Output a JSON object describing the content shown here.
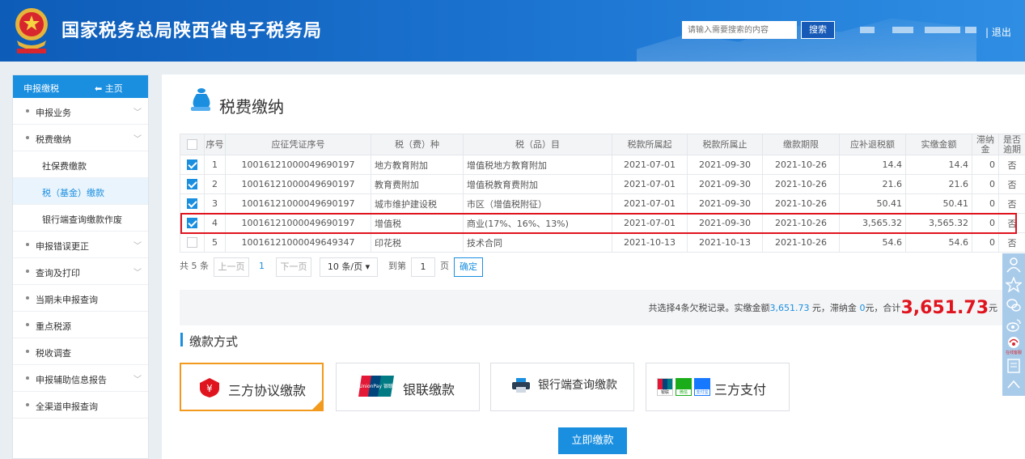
{
  "header": {
    "title": "国家税务总局陕西省电子税务局",
    "search_placeholder": "请输入需要搜索的内容",
    "search_label": "搜索",
    "separator": "|",
    "logout_label": "退出"
  },
  "sidebar": {
    "head_label": "申报缴税",
    "home_label": "主页",
    "items": [
      {
        "label": "申报业务",
        "expandable": true
      },
      {
        "label": "税费缴纳",
        "expandable": true
      },
      {
        "label": "社保费缴款",
        "sub": true
      },
      {
        "label": "税（基金）缴款",
        "sub": true,
        "active": true
      },
      {
        "label": "银行端查询缴款作废",
        "sub": true
      },
      {
        "label": "申报错误更正",
        "expandable": true
      },
      {
        "label": "查询及打印",
        "expandable": true
      },
      {
        "label": "当期未申报查询"
      },
      {
        "label": "重点税源"
      },
      {
        "label": "税收调查"
      },
      {
        "label": "申报辅助信息报告",
        "expandable": true
      },
      {
        "label": "全渠道申报查询"
      }
    ]
  },
  "page_title": "税费缴纳",
  "table": {
    "headers": [
      "",
      "序号",
      "应征凭证序号",
      "税（费）种",
      "税（品）目",
      "税款所属起",
      "税款所属止",
      "缴款期限",
      "应补退税额",
      "实缴金额",
      "滞纳金",
      "是否逾期"
    ],
    "rows": [
      {
        "checked": true,
        "cells": [
          "1",
          "10016121000049690197",
          "地方教育附加",
          "增值税地方教育附加",
          "2021-07-01",
          "2021-09-30",
          "2021-10-26",
          "14.4",
          "14.4",
          "0",
          "否"
        ]
      },
      {
        "checked": true,
        "cells": [
          "2",
          "10016121000049690197",
          "教育费附加",
          "增值税教育费附加",
          "2021-07-01",
          "2021-09-30",
          "2021-10-26",
          "21.6",
          "21.6",
          "0",
          "否"
        ]
      },
      {
        "checked": true,
        "cells": [
          "3",
          "10016121000049690197",
          "城市维护建设税",
          "市区（增值税附征）",
          "2021-07-01",
          "2021-09-30",
          "2021-10-26",
          "50.41",
          "50.41",
          "0",
          "否"
        ]
      },
      {
        "checked": true,
        "cells": [
          "4",
          "10016121000049690197",
          "增值税",
          "商业(17%、16%、13%)",
          "2021-07-01",
          "2021-09-30",
          "2021-10-26",
          "3,565.32",
          "3,565.32",
          "0",
          "否"
        ]
      },
      {
        "checked": false,
        "cells": [
          "5",
          "10016121000049649347",
          "印花税",
          "技术合同",
          "2021-10-13",
          "2021-10-13",
          "2021-10-26",
          "54.6",
          "54.6",
          "0",
          "否"
        ]
      }
    ]
  },
  "pager": {
    "total": "共 5 条",
    "prev": "上一页",
    "current": "1",
    "next": "下一页",
    "per_page": "10 条/页",
    "goto_prefix": "到第",
    "goto_value": "1",
    "goto_suffix": "页",
    "confirm": "确定"
  },
  "summary": {
    "prefix": "共选择4条欠税记录。实缴金额",
    "amount": "3,651.73",
    "mid1": " 元，滞纳金 ",
    "late_fee": "0",
    "mid2": "元，合计",
    "total": "3,651.73",
    "suffix": "元"
  },
  "payment_methods": {
    "title": "缴款方式",
    "options": [
      {
        "label": "三方协议缴款",
        "icon": "shield-icon",
        "selected": true
      },
      {
        "label": "银联缴款",
        "icon": "unionpay-icon",
        "logo_text": "UnionPay 银联"
      },
      {
        "label": "银行端查询缴款",
        "icon": "printer-icon"
      },
      {
        "label": "三方支付",
        "icon": "payment-logos-icon",
        "logo_texts": [
          "银联",
          "微信",
          "支付宝"
        ]
      }
    ],
    "pay_now_label": "立即缴款"
  },
  "float_rail": {
    "icons": [
      "user-icon",
      "star-icon",
      "wechat-icon",
      "weibo-icon",
      "customer-service-icon",
      "document-icon",
      "arrow-up-icon"
    ],
    "service_label": "在线客服"
  },
  "colors": {
    "header_blue": "#0d5cb8",
    "accent_blue": "#1a8fe0",
    "highlight_red": "#e0141e",
    "selected_orange": "#f29a1d"
  }
}
